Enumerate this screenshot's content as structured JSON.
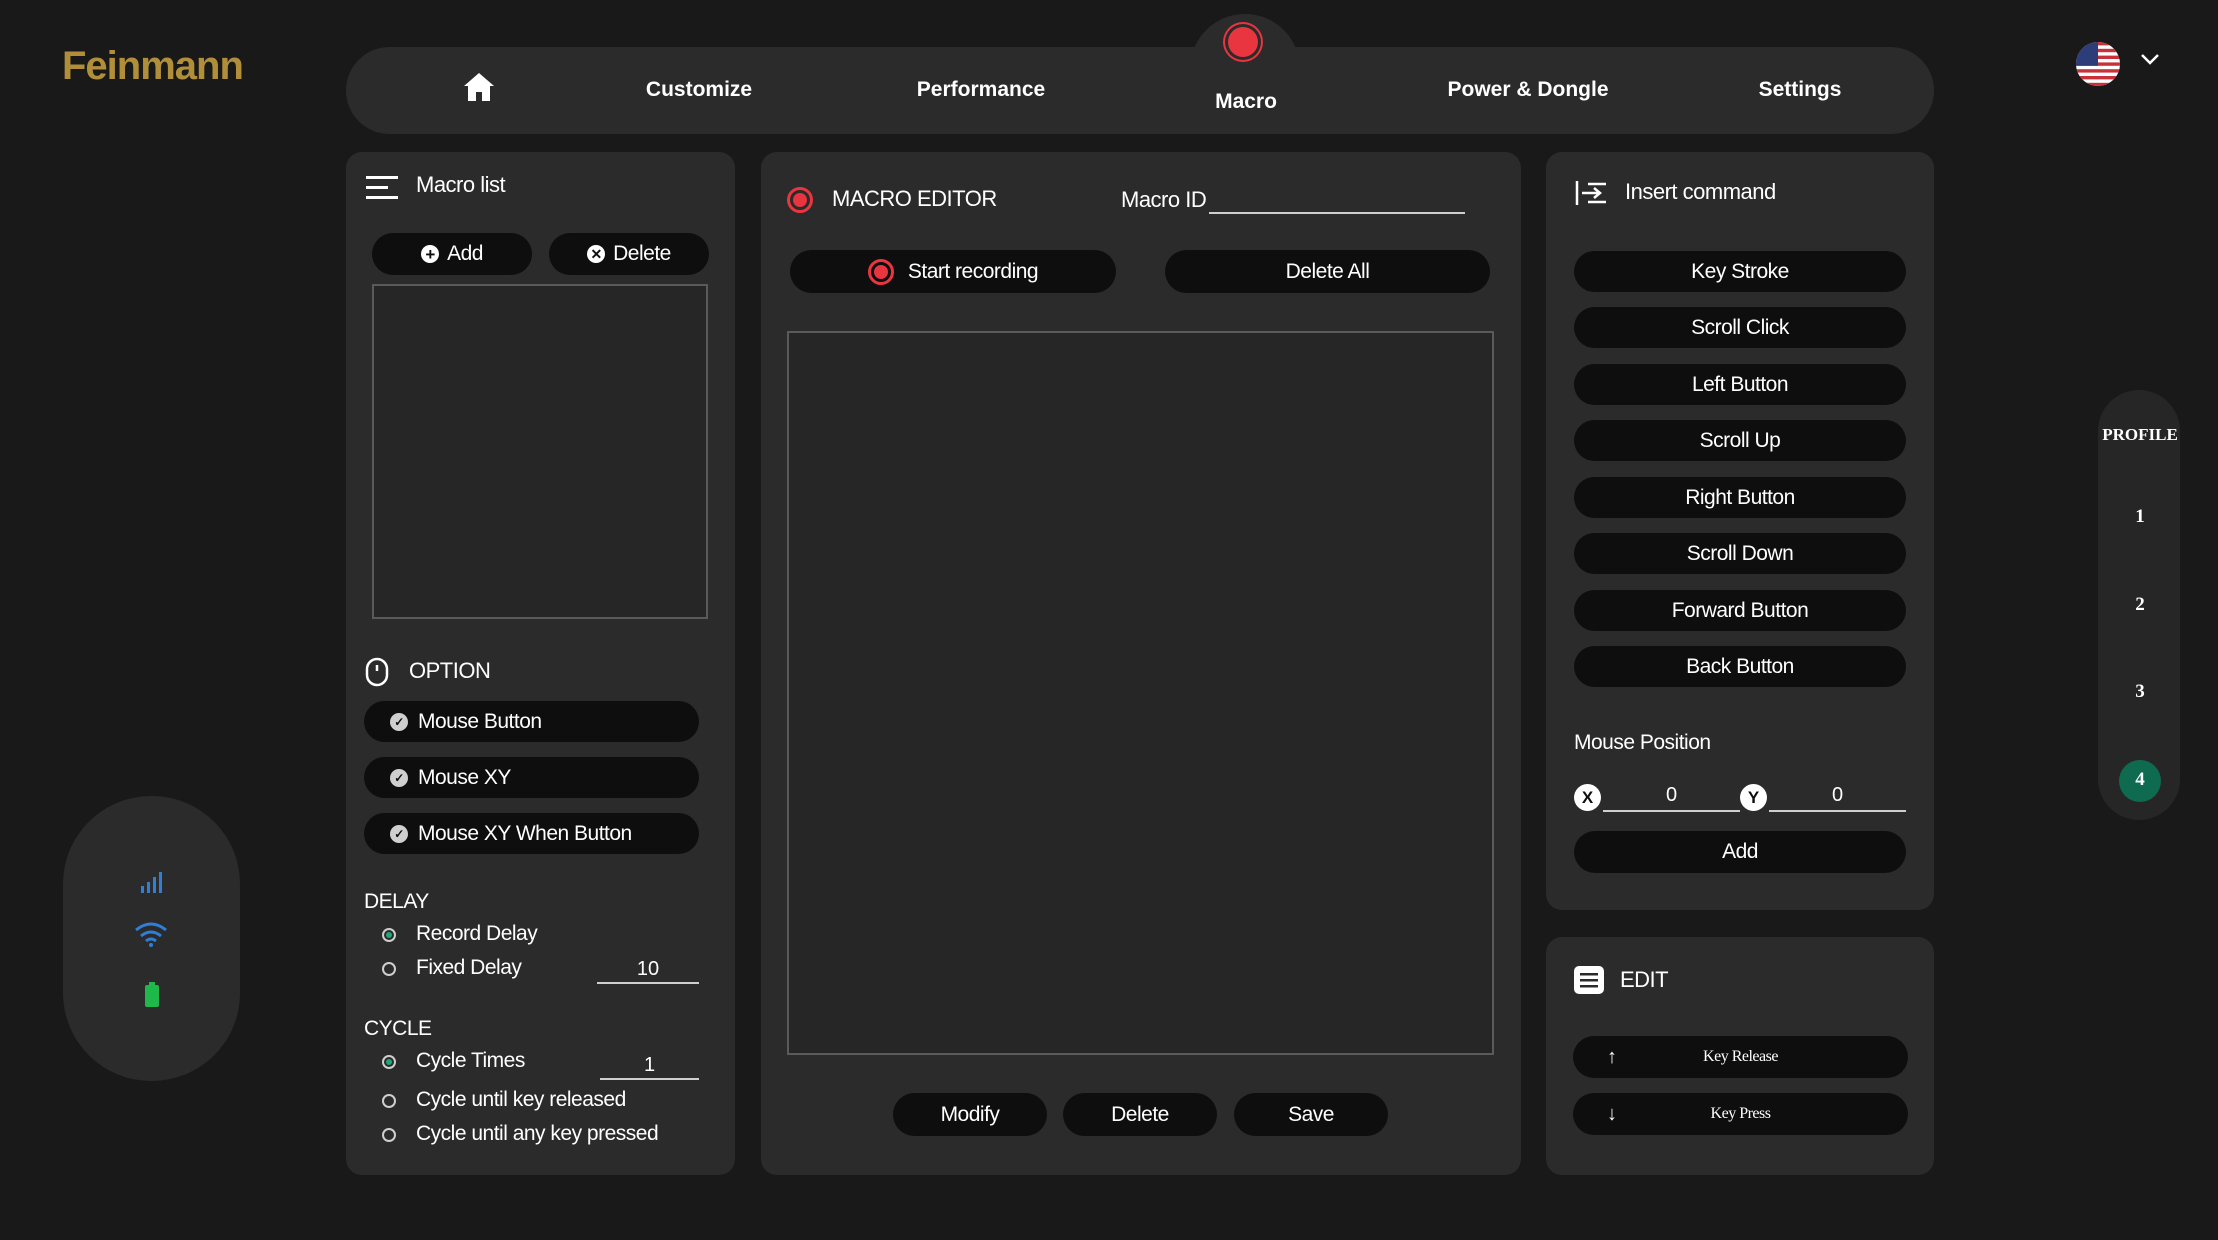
{
  "brand": {
    "logo_text": "Feinmann",
    "logo_color": "#b08e3a"
  },
  "nav": {
    "home_icon": "home-icon",
    "items": [
      "Customize",
      "Performance",
      "Macro",
      "Power & Dongle",
      "Settings"
    ],
    "active": "Macro"
  },
  "language": {
    "flag_icon": "us-flag-icon",
    "chevron_icon": "chevron-down-icon"
  },
  "macro_list": {
    "title": "Macro list",
    "add_label": "Add",
    "delete_label": "Delete"
  },
  "option": {
    "title": "OPTION",
    "buttons": [
      "Mouse Button",
      "Mouse XY",
      "Mouse XY When Button"
    ]
  },
  "delay": {
    "title": "DELAY",
    "record_delay": "Record Delay",
    "fixed_delay": "Fixed Delay",
    "fixed_delay_value": "10",
    "selected": "Record Delay"
  },
  "cycle": {
    "title": "CYCLE",
    "cycle_times": "Cycle Times",
    "cycle_times_value": "1",
    "until_released": "Cycle until key released",
    "until_any": "Cycle until any key pressed",
    "selected": "Cycle Times"
  },
  "editor": {
    "title": "MACRO EDITOR",
    "macro_id_label": "Macro ID",
    "macro_id_value": "",
    "start_recording": "Start recording",
    "delete_all": "Delete All",
    "modify": "Modify",
    "delete": "Delete",
    "save": "Save"
  },
  "insert": {
    "title": "Insert command",
    "commands": [
      "Key Stroke",
      "Scroll Click",
      "Left Button",
      "Scroll Up",
      "Right Button",
      "Scroll Down",
      "Forward Button",
      "Back Button"
    ],
    "mouse_position_title": "Mouse Position",
    "x_label": "X",
    "x_value": "0",
    "y_label": "Y",
    "y_value": "0",
    "add_label": "Add"
  },
  "edit": {
    "title": "EDIT",
    "key_release": "Key Release",
    "key_press": "Key Press"
  },
  "profile": {
    "title": "PROFILE",
    "items": [
      "1",
      "2",
      "3",
      "4"
    ],
    "active": "4",
    "active_color": "#0f6b4f"
  },
  "status": {
    "icons": [
      "signal-bars-icon",
      "wifi-icon",
      "battery-icon"
    ],
    "accent": "#2f7fd9",
    "battery_color": "#1fb84a"
  },
  "colors": {
    "background": "#191919",
    "panel": "#2b2b2b",
    "pill": "#0e0e0e",
    "record": "#e8353f"
  }
}
